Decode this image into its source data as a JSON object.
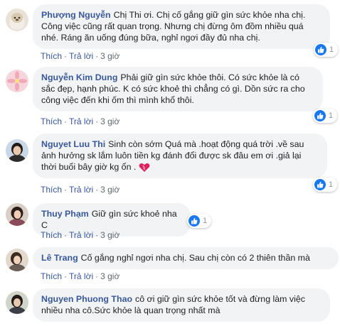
{
  "comments": [
    {
      "author": "Phượng Nguyễn",
      "text": "Chị Thi ơi. Chị cố gắng giữ gìn sức khỏe nha chị. Công việc cũng rất quan trọng. Nhưng chị đừng ôm đồm nhiều quá nhé. Ráng ăn uống đúng bữa, nghỉ ngơi đầy đủ nha chị.",
      "like_label": "Thích",
      "reply_label": "Trả lời",
      "time": "3 giờ",
      "reaction_count": "1"
    },
    {
      "author": "Nguyễn Kim Dung",
      "text": "Phải giữ gìn sức khỏe thôi. Có sức khỏe là có sắc đẹp, hạnh phúc. K có sức khoẻ thì chẳng có gì. Dồn sức ra cho công việc đến khi ốm thì mình khổ thôi.",
      "like_label": "Thích",
      "reply_label": "Trả lời",
      "time": "3 giờ",
      "reaction_count": "1"
    },
    {
      "author": "Nguyet Luu Thi",
      "text": "Sinh còn sớm Quá mà .hoạt động quá trời .về sau ảnh hưởng sk lắm luôn tiền kg đánh đổi được sk đâu em ơi .giả lại thời buổi bây giờ kg ổn .",
      "like_label": "Thích",
      "reply_label": "Trả lời",
      "time": "3 giờ",
      "reaction_count": "1"
    },
    {
      "author": "Thuy Phạm",
      "text": "Giữ gìn sức khoẻ nha C",
      "like_label": "Thích",
      "reply_label": "Trả lời",
      "time": "3 giờ",
      "reaction_count": "1"
    },
    {
      "author": "Lê Trang",
      "text": "Cố gắng nghỉ ngơi nha chị. Sau chị còn có 2 thiên thần mà",
      "like_label": "Thích",
      "reply_label": "Trả lời",
      "time": "3 giờ"
    },
    {
      "author": "Nguyen Phuong Thao",
      "text": "cô ơi giữ gìn sức khỏe tốt và đừng làm việc nhiều nha cô.Sức khỏe là quan trọng nhất mà"
    }
  ],
  "colors": {
    "author": "#385898",
    "bubble": "#f2f3f5",
    "like_blue": "#1877f2",
    "meta": "#606770"
  },
  "icons": {
    "like": "thumbs-up-icon",
    "heart": "heart-emoji-icon"
  }
}
